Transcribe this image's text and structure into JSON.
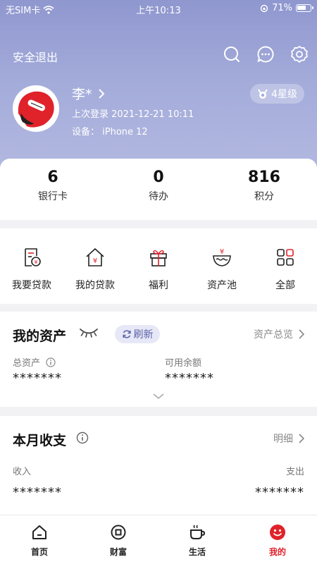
{
  "status_bar": {
    "carrier": "无SIM卡",
    "time": "上午10:13",
    "battery": "71%"
  },
  "header": {
    "logout_label": "安全退出"
  },
  "profile": {
    "name": "李*",
    "last_login": "上次登录 2021-12-21 10:11",
    "device": "设备： iPhone 12",
    "star_level": "4星级"
  },
  "stats": [
    {
      "value": "6",
      "label": "银行卡"
    },
    {
      "value": "0",
      "label": "待办"
    },
    {
      "value": "816",
      "label": "积分"
    }
  ],
  "quick_actions": [
    {
      "label": "我要贷款",
      "icon": "loan-apply-icon"
    },
    {
      "label": "我的贷款",
      "icon": "my-loan-icon"
    },
    {
      "label": "福利",
      "icon": "gift-icon"
    },
    {
      "label": "资产池",
      "icon": "asset-pool-icon"
    },
    {
      "label": "全部",
      "icon": "grid-icon"
    }
  ],
  "assets": {
    "title": "我的资产",
    "refresh_label": "刷新",
    "overview_label": "资产总览",
    "total_label": "总资产",
    "total_value": "*******",
    "available_label": "可用余额",
    "available_value": "*******"
  },
  "monthly": {
    "title": "本月收支",
    "detail_label": "明细",
    "income_label": "收入",
    "income_value": "*******",
    "expense_label": "支出",
    "expense_value": "*******"
  },
  "tabbar": [
    {
      "label": "首页",
      "icon": "home-icon"
    },
    {
      "label": "财富",
      "icon": "wealth-icon"
    },
    {
      "label": "生活",
      "icon": "coffee-icon"
    },
    {
      "label": "我的",
      "icon": "profile-icon",
      "active": true
    }
  ],
  "colors": {
    "accent": "#e0222a",
    "header": "#9aa1d6",
    "refresh_bg": "#e7e8f7"
  }
}
